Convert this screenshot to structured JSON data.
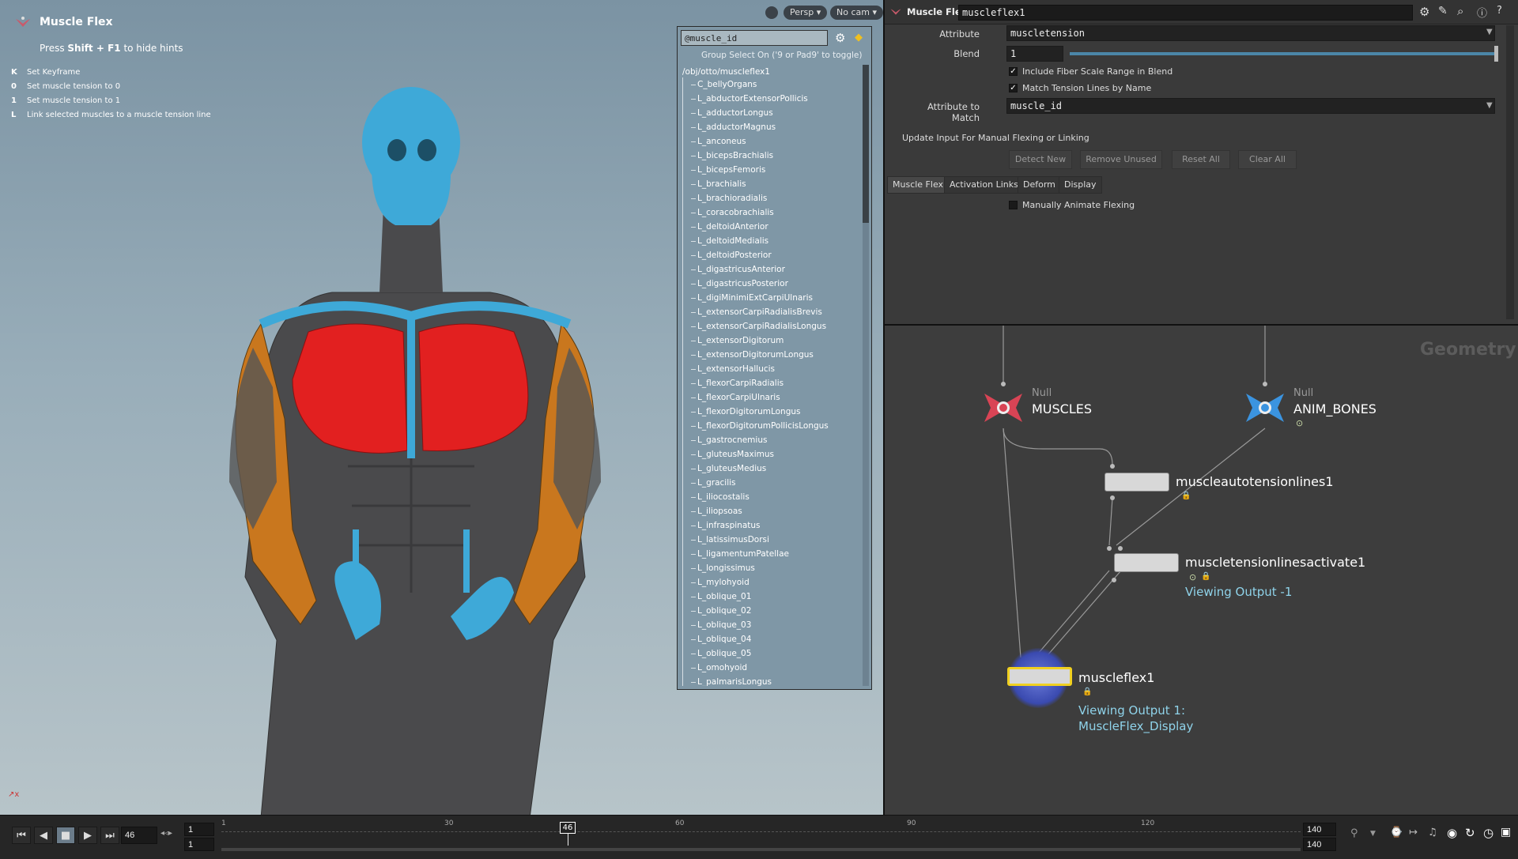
{
  "viewport": {
    "title": "Muscle Flex",
    "hint_prefix": "Press ",
    "hint_keys": "Shift + F1",
    "hint_suffix": " to hide hints",
    "hotkeys": [
      {
        "key": "K",
        "label": "Set Keyframe"
      },
      {
        "key": "0",
        "label": "Set muscle tension to 0"
      },
      {
        "key": "1",
        "label": "Set muscle tension to 1"
      },
      {
        "key": "L",
        "label": "Link selected muscles to a muscle tension line"
      }
    ],
    "persp_label": "Persp",
    "cam_label": "No cam"
  },
  "group_list": {
    "input_value": "@muscle_id",
    "hint": "Group Select On ('9 or Pad9' to toggle)",
    "root_path": "/obj/otto/muscleflex1",
    "items": [
      "C_bellyOrgans",
      "L_abductorExtensorPollicis",
      "L_adductorLongus",
      "L_adductorMagnus",
      "L_anconeus",
      "L_bicepsBrachialis",
      "L_bicepsFemoris",
      "L_brachialis",
      "L_brachioradialis",
      "L_coracobrachialis",
      "L_deltoidAnterior",
      "L_deltoidMedialis",
      "L_deltoidPosterior",
      "L_digastricusAnterior",
      "L_digastricusPosterior",
      "L_digiMinimiExtCarpiUlnaris",
      "L_extensorCarpiRadialisBrevis",
      "L_extensorCarpiRadialisLongus",
      "L_extensorDigitorum",
      "L_extensorDigitorumLongus",
      "L_extensorHallucis",
      "L_flexorCarpiRadialis",
      "L_flexorCarpiUlnaris",
      "L_flexorDigitorumLongus",
      "L_flexorDigitorumPollicisLongus",
      "L_gastrocnemius",
      "L_gluteusMaximus",
      "L_gluteusMedius",
      "L_gracilis",
      "L_iliocostalis",
      "L_iliopsoas",
      "L_infraspinatus",
      "L_latissimusDorsi",
      "L_ligamentumPatellae",
      "L_longissimus",
      "L_mylohyoid",
      "L_oblique_01",
      "L_oblique_02",
      "L_oblique_03",
      "L_oblique_04",
      "L_oblique_05",
      "L_omohyoid",
      "L_palmarisLongus"
    ]
  },
  "params": {
    "node_type": "Muscle Flex",
    "node_name": "muscleflex1",
    "attribute_label": "Attribute",
    "attribute_value": "muscletension",
    "blend_label": "Blend",
    "blend_value": "1",
    "blend_fraction": 1.0,
    "check1_label": "Include Fiber Scale Range in Blend",
    "check2_label": "Match Tension Lines by Name",
    "match_label": "Attribute to Match",
    "match_value": "muscle_id",
    "section_label": "Update Input For Manual Flexing or Linking",
    "buttons": [
      "Detect New",
      "Remove Unused",
      "Reset All",
      "Clear All"
    ],
    "tabs": [
      "Muscle Flex",
      "Activation Links",
      "Deform",
      "Display"
    ],
    "manual_label": "Manually Animate Flexing"
  },
  "network": {
    "context_label": "Geometry",
    "nodes": {
      "muscles": {
        "type": "Null",
        "name": "MUSCLES"
      },
      "anim_bones": {
        "type": "Null",
        "name": "ANIM_BONES"
      },
      "autotension": {
        "name": "muscleautotensionlines1"
      },
      "activate": {
        "name": "muscletensionlinesactivate1",
        "sub": "Viewing Output -1"
      },
      "flex": {
        "name": "muscleflex1",
        "sub1": "Viewing Output 1:",
        "sub2": "MuscleFlex_Display"
      }
    }
  },
  "timeline": {
    "current_frame": "46",
    "start_a": "1",
    "start_b": "1",
    "end_a": "140",
    "end_b": "140",
    "tick_labels": [
      "1",
      "30",
      "60",
      "90",
      "120"
    ],
    "marker_label": "46"
  },
  "colors": {
    "skull": "#3ea9d8",
    "chest": "#e22020",
    "arm": "#c9771e",
    "body": "#4a4a4c"
  }
}
